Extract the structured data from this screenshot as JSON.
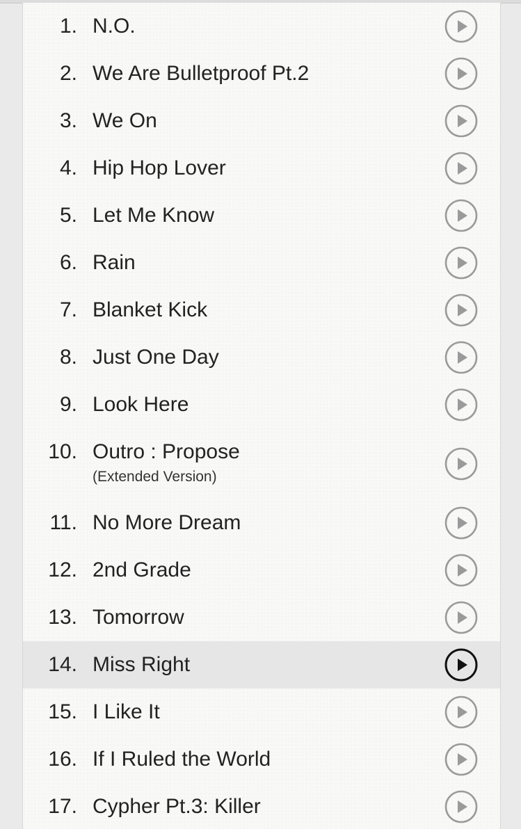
{
  "tracklist": {
    "tracks": [
      {
        "number": "1.",
        "title": "N.O.",
        "subtitle": "",
        "active": false
      },
      {
        "number": "2.",
        "title": "We Are Bulletproof Pt.2",
        "subtitle": "",
        "active": false
      },
      {
        "number": "3.",
        "title": "We On",
        "subtitle": "",
        "active": false
      },
      {
        "number": "4.",
        "title": "Hip Hop Lover",
        "subtitle": "",
        "active": false
      },
      {
        "number": "5.",
        "title": "Let Me Know",
        "subtitle": "",
        "active": false
      },
      {
        "number": "6.",
        "title": "Rain",
        "subtitle": "",
        "active": false
      },
      {
        "number": "7.",
        "title": "Blanket Kick",
        "subtitle": "",
        "active": false
      },
      {
        "number": "8.",
        "title": "Just One Day",
        "subtitle": "",
        "active": false
      },
      {
        "number": "9.",
        "title": "Look Here",
        "subtitle": "",
        "active": false
      },
      {
        "number": "10.",
        "title": "Outro : Propose",
        "subtitle": "(Extended Version)",
        "active": false
      },
      {
        "number": "11.",
        "title": "No More Dream",
        "subtitle": "",
        "active": false
      },
      {
        "number": "12.",
        "title": "2nd Grade",
        "subtitle": "",
        "active": false
      },
      {
        "number": "13.",
        "title": "Tomorrow",
        "subtitle": "",
        "active": false
      },
      {
        "number": "14.",
        "title": "Miss Right",
        "subtitle": "",
        "active": true
      },
      {
        "number": "15.",
        "title": "I Like It",
        "subtitle": "",
        "active": false
      },
      {
        "number": "16.",
        "title": "If I Ruled the World",
        "subtitle": "",
        "active": false
      },
      {
        "number": "17.",
        "title": "Cypher Pt.3: Killer",
        "subtitle": "",
        "active": false
      }
    ],
    "play_icon": "play-circle-icon",
    "colors": {
      "icon_inactive": "#9a9a9a",
      "icon_active": "#111111",
      "active_row_bg": "#e6e6e6",
      "text": "#222222"
    }
  }
}
